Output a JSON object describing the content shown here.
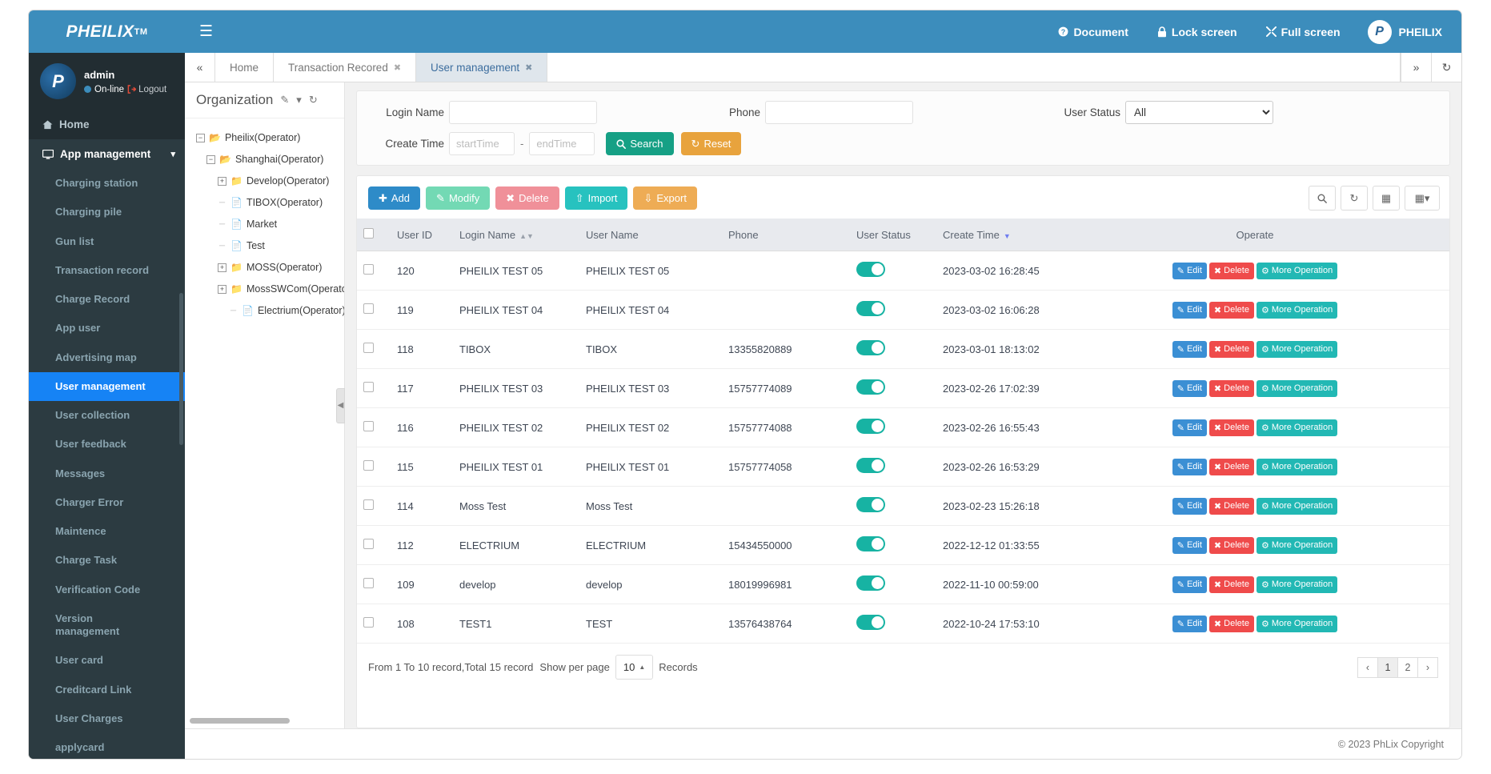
{
  "brand": {
    "name": "PHEILIX",
    "tm": "TM"
  },
  "topnav": {
    "menu_icon": "hamburger-icon",
    "links": [
      {
        "label": "Document",
        "icon": "question-circle-icon"
      },
      {
        "label": "Lock screen",
        "icon": "lock-icon"
      },
      {
        "label": "Full screen",
        "icon": "expand-icon"
      }
    ],
    "user": "PHEILIX"
  },
  "sidebar": {
    "user": {
      "name": "admin",
      "status": "On-line",
      "logout": "Logout"
    },
    "home": "Home",
    "section": {
      "label": "App management",
      "icon": "desktop-icon"
    },
    "items": [
      {
        "label": "Charging station",
        "active": false
      },
      {
        "label": "Charging pile",
        "active": false
      },
      {
        "label": "Gun list",
        "active": false
      },
      {
        "label": "Transaction record",
        "active": false
      },
      {
        "label": "Charge Record",
        "active": false
      },
      {
        "label": "App user",
        "active": false
      },
      {
        "label": "Advertising map",
        "active": false
      },
      {
        "label": "User management",
        "active": true
      },
      {
        "label": "User collection",
        "active": false
      },
      {
        "label": "User feedback",
        "active": false
      },
      {
        "label": "Messages",
        "active": false
      },
      {
        "label": "Charger Error",
        "active": false
      },
      {
        "label": "Maintence",
        "active": false
      },
      {
        "label": "Charge Task",
        "active": false
      },
      {
        "label": "Verification Code",
        "active": false
      },
      {
        "label": "Version management",
        "active": false
      },
      {
        "label": "User card",
        "active": false
      },
      {
        "label": "Creditcard Link",
        "active": false
      },
      {
        "label": "User Charges",
        "active": false
      },
      {
        "label": "applycard",
        "active": false
      }
    ]
  },
  "tabs": {
    "prev_icon": "chevron-double-left-icon",
    "next_icon": "chevron-double-right-icon",
    "refresh_icon": "refresh-icon",
    "items": [
      {
        "label": "Home",
        "closable": false,
        "active": false
      },
      {
        "label": "Transaction Recored",
        "closable": true,
        "active": false
      },
      {
        "label": "User management",
        "closable": true,
        "active": true
      }
    ]
  },
  "org": {
    "title": "Organization",
    "edit_icon": "edit-icon",
    "collapse_icon": "chevron-down-icon",
    "refresh_icon": "refresh-icon",
    "tree": [
      {
        "label": "Pheilix(Operator)",
        "depth": 0,
        "toggle": "minus",
        "icon": "folder-open-icon"
      },
      {
        "label": "Shanghai(Operator)",
        "depth": 1,
        "toggle": "minus",
        "icon": "folder-open-icon"
      },
      {
        "label": "Develop(Operator)",
        "depth": 2,
        "toggle": "plus",
        "icon": "folder-icon"
      },
      {
        "label": "TIBOX(Operator)",
        "depth": 2,
        "toggle": "none",
        "icon": "file-icon"
      },
      {
        "label": "Market",
        "depth": 2,
        "toggle": "none",
        "icon": "file-icon"
      },
      {
        "label": "Test",
        "depth": 2,
        "toggle": "none",
        "icon": "file-icon"
      },
      {
        "label": "MOSS(Operator)",
        "depth": 2,
        "toggle": "plus",
        "icon": "folder-icon"
      },
      {
        "label": "MossSWCom(Operator)",
        "depth": 2,
        "toggle": "plus",
        "icon": "folder-icon"
      },
      {
        "label": "Electrium(Operator)",
        "depth": 3,
        "toggle": "none",
        "icon": "file-icon"
      }
    ]
  },
  "filter": {
    "login_name_label": "Login Name",
    "login_name_value": "",
    "phone_label": "Phone",
    "phone_value": "",
    "user_status_label": "User Status",
    "user_status_value": "All",
    "user_status_options": [
      "All"
    ],
    "create_time_label": "Create Time",
    "start_time_placeholder": "startTime",
    "end_time_placeholder": "endTime",
    "time_separator": "-",
    "search_label": "Search",
    "search_icon": "search-icon",
    "reset_label": "Reset",
    "reset_icon": "refresh-icon"
  },
  "toolbar": {
    "add_label": "Add",
    "modify_label": "Modify",
    "delete_label": "Delete",
    "import_label": "Import",
    "export_label": "Export",
    "search_icon": "search-icon",
    "refresh_icon": "refresh-icon",
    "columns_icon": "list-icon",
    "grid_icon": "grid-icon"
  },
  "table": {
    "columns": [
      "User ID",
      "Login Name",
      "User Name",
      "Phone",
      "User Status",
      "Create Time",
      "Operate"
    ],
    "sort": {
      "login_name": "both",
      "create_time": "desc"
    },
    "ops": {
      "edit": "Edit",
      "delete": "Delete",
      "more": "More Operation"
    },
    "rows": [
      {
        "user_id": "120",
        "login_name": "PHEILIX TEST 05",
        "user_name": "PHEILIX TEST 05",
        "phone": "",
        "status": true,
        "create_time": "2023-03-02 16:28:45"
      },
      {
        "user_id": "119",
        "login_name": "PHEILIX TEST 04",
        "user_name": "PHEILIX TEST 04",
        "phone": "",
        "status": true,
        "create_time": "2023-03-02 16:06:28"
      },
      {
        "user_id": "118",
        "login_name": "TIBOX",
        "user_name": "TIBOX",
        "phone": "13355820889",
        "status": true,
        "create_time": "2023-03-01 18:13:02"
      },
      {
        "user_id": "117",
        "login_name": "PHEILIX TEST 03",
        "user_name": "PHEILIX TEST 03",
        "phone": "15757774089",
        "status": true,
        "create_time": "2023-02-26 17:02:39"
      },
      {
        "user_id": "116",
        "login_name": "PHEILIX TEST 02",
        "user_name": "PHEILIX TEST 02",
        "phone": "15757774088",
        "status": true,
        "create_time": "2023-02-26 16:55:43"
      },
      {
        "user_id": "115",
        "login_name": "PHEILIX TEST 01",
        "user_name": "PHEILIX TEST 01",
        "phone": "15757774058",
        "status": true,
        "create_time": "2023-02-26 16:53:29"
      },
      {
        "user_id": "114",
        "login_name": "Moss Test",
        "user_name": "Moss Test",
        "phone": "",
        "status": true,
        "create_time": "2023-02-23 15:26:18"
      },
      {
        "user_id": "112",
        "login_name": "ELECTRIUM",
        "user_name": "ELECTRIUM",
        "phone": "15434550000",
        "status": true,
        "create_time": "2022-12-12 01:33:55"
      },
      {
        "user_id": "109",
        "login_name": "develop",
        "user_name": "develop",
        "phone": "18019996981",
        "status": true,
        "create_time": "2022-11-10 00:59:00"
      },
      {
        "user_id": "108",
        "login_name": "TEST1",
        "user_name": "TEST",
        "phone": "13576438764",
        "status": true,
        "create_time": "2022-10-24 17:53:10"
      }
    ]
  },
  "pagination": {
    "summary": "From 1 To 10 record,Total 15 record",
    "show_per_page_label": "Show per page",
    "per_page_value": "10",
    "records_label": "Records",
    "prev": "‹",
    "next": "›",
    "pages": [
      "1",
      "2"
    ],
    "current_page": "1"
  },
  "footer": {
    "copyright": "© 2023 PhLix Copyright"
  }
}
